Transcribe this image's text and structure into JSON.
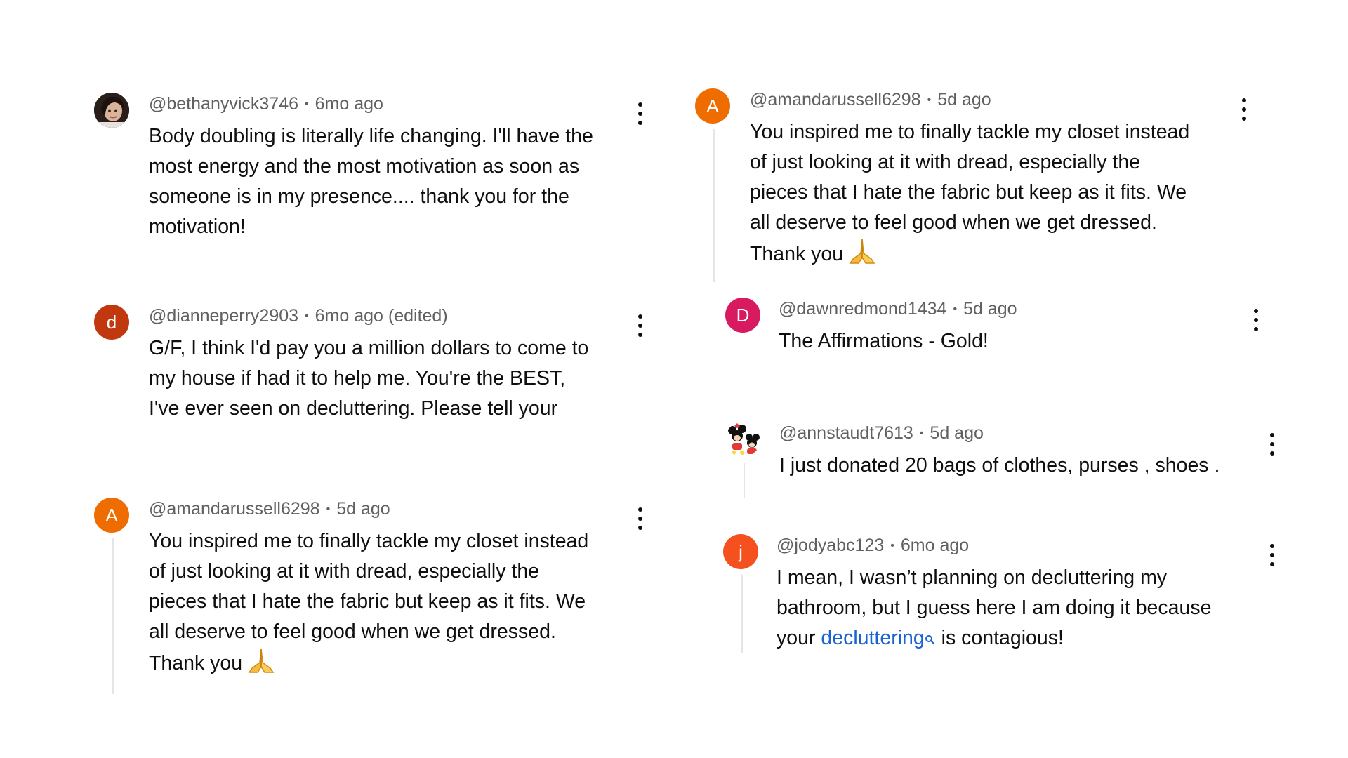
{
  "comments": [
    {
      "handle": "@bethanyvick3746",
      "time": "6mo ago",
      "lines": [
        "Body doubling is literally life changing. I'll have the",
        "most energy and the most motivation as soon as",
        "someone is in my presence.... thank you for the",
        "motivation!"
      ],
      "avatar_type": "photo"
    },
    {
      "handle": "@dianneperry2903",
      "time": "6mo ago (edited)",
      "lines": [
        "G/F, I think I'd pay you a million dollars to come to",
        "my house if had it to help me. You're the BEST,",
        "I've ever seen on decluttering. Please tell your"
      ],
      "avatar_letter": "d",
      "avatar_color": "#c1380f"
    },
    {
      "handle": "@amandarussell6298",
      "time": "5d ago",
      "lines": [
        "You inspired me to finally tackle my closet instead",
        "of just looking at it with dread, especially the",
        "pieces that I hate the fabric but keep as it fits. We",
        "all deserve to feel good when we get dressed.",
        "Thank you"
      ],
      "emoji": "folded-hands-emoji",
      "avatar_letter": "A",
      "avatar_color": "#ef6c00"
    },
    {
      "handle": "@amandarussell6298",
      "time": "5d ago",
      "lines": [
        "You inspired me to finally tackle my closet instead",
        "of just looking at it with dread, especially the",
        "pieces that I hate the fabric but keep as it fits. We",
        "all deserve to feel good when we get dressed.",
        "Thank you"
      ],
      "emoji": "folded-hands-emoji",
      "avatar_letter": "A",
      "avatar_color": "#ef6c00"
    },
    {
      "handle": "@dawnredmond1434",
      "time": "5d ago",
      "lines": [
        "The Affirmations - Gold!"
      ],
      "avatar_letter": "D",
      "avatar_color": "#d81b60"
    },
    {
      "handle": "@annstaudt7613",
      "time": "5d ago",
      "lines": [
        "I just donated 20 bags of clothes, purses , shoes ."
      ],
      "avatar_type": "cartoon"
    },
    {
      "handle": "@jodyabc123",
      "time": "6mo ago",
      "lines": [
        "I mean, I wasn’t planning on decluttering my",
        "bathroom, but I guess here I am doing it because"
      ],
      "last_line_before": "your ",
      "last_line_link": "decluttering",
      "last_line_after": " is contagious!",
      "avatar_letter": "j",
      "avatar_color": "#f4511e"
    }
  ],
  "colors": {
    "text": "#0f0f0f",
    "meta": "#606060",
    "link": "#1a63d1",
    "thread_line": "#e5e5e5"
  },
  "icons": {
    "more": "vertical-ellipsis-icon",
    "search_hint": "magnifier-icon",
    "emoji": "folded-hands-emoji"
  }
}
